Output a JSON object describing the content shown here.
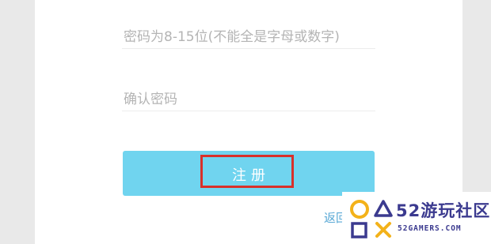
{
  "form": {
    "password_placeholder": "密码为8-15位(不能全是字母或数字)",
    "confirm_placeholder": "确认密码",
    "register_label": "注册",
    "back_link_label": "返回"
  },
  "watermark": {
    "brand": "52游玩社区",
    "domain": "52GAMERS.COM",
    "brand_color": "#3b3a8f",
    "accent_color": "#f3b21a"
  },
  "colors": {
    "button": "#70d4ef",
    "highlight": "#d9302a",
    "link": "#5aa9d6"
  }
}
